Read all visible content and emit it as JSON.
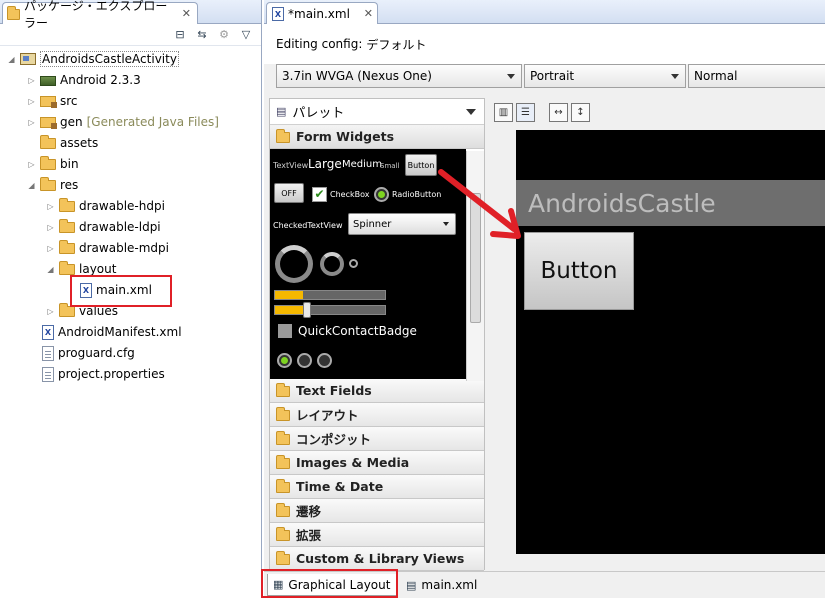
{
  "package_explorer": {
    "tab_title": "パッケージ・エクスプローラー",
    "tree": [
      {
        "label": "AndroidsCastleActivity",
        "icon": "project-icon",
        "twisty": "expanded"
      },
      {
        "label": "Android 2.3.3",
        "icon": "library-icon",
        "twisty": "collapsed"
      },
      {
        "label": "src",
        "icon": "package-folder-icon",
        "twisty": "collapsed"
      },
      {
        "label": "gen",
        "suffix": "[Generated Java Files]",
        "icon": "package-folder-icon",
        "twisty": "collapsed"
      },
      {
        "label": "assets",
        "icon": "folder-icon",
        "twisty": "none"
      },
      {
        "label": "bin",
        "icon": "folder-icon",
        "twisty": "collapsed"
      },
      {
        "label": "res",
        "icon": "folder-icon",
        "twisty": "expanded"
      },
      {
        "label": "drawable-hdpi",
        "icon": "folder-icon",
        "twisty": "collapsed"
      },
      {
        "label": "drawable-ldpi",
        "icon": "folder-icon",
        "twisty": "collapsed"
      },
      {
        "label": "drawable-mdpi",
        "icon": "folder-icon",
        "twisty": "collapsed"
      },
      {
        "label": "layout",
        "icon": "folder-icon",
        "twisty": "expanded"
      },
      {
        "label": "main.xml",
        "icon": "xml-file-icon",
        "twisty": "none",
        "highlighted": true
      },
      {
        "label": "values",
        "icon": "folder-icon",
        "twisty": "collapsed"
      },
      {
        "label": "AndroidManifest.xml",
        "icon": "xml-file-icon",
        "twisty": "none"
      },
      {
        "label": "proguard.cfg",
        "icon": "file-icon",
        "twisty": "none"
      },
      {
        "label": "project.properties",
        "icon": "file-icon",
        "twisty": "none"
      }
    ]
  },
  "editor": {
    "tab_title": "*main.xml",
    "config_label": "Editing config:",
    "config_value": "デフォルト",
    "device_combo": "3.7in WVGA (Nexus One)",
    "orientation_combo": "Portrait",
    "theme_combo": "Normal",
    "palette": {
      "title": "パレット",
      "open_category": "Form Widgets",
      "categories": [
        "Text Fields",
        "レイアウト",
        "コンポジット",
        "Images & Media",
        "Time & Date",
        "遷移",
        "拡張",
        "Custom & Library Views"
      ],
      "widgets": {
        "textview": "TextView",
        "large": "Large",
        "medium": "Medium",
        "small": "Small",
        "button": "Button",
        "toggle_off": "OFF",
        "checkbox": "CheckBox",
        "radiobutton": "RadioButton",
        "checkedtextview": "CheckedTextView",
        "spinner": "Spinner",
        "quickcontactbadge": "QuickContactBadge",
        "progress_level": 0.25,
        "seek_level": 0.25
      }
    },
    "canvas": {
      "app_title": "AndroidsCastle",
      "button_label": "Button"
    },
    "bottom_tabs": [
      "Graphical Layout",
      "main.xml"
    ]
  },
  "colors": {
    "highlight": "#e02027",
    "device_bg": "#000000",
    "title_bar": "#6e6e6e",
    "progress": "#f5b800"
  }
}
